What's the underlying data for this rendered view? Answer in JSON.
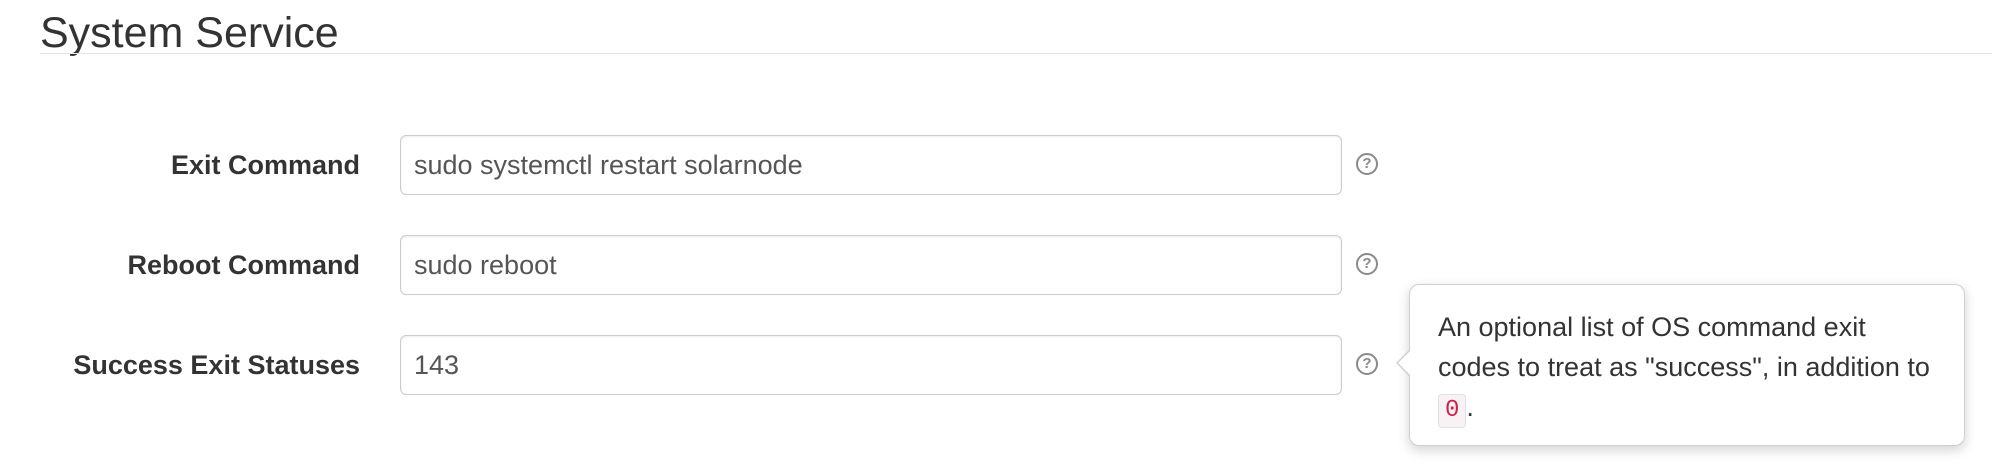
{
  "section": {
    "title": "System Service"
  },
  "fields": [
    {
      "label": "Exit Command",
      "value": "sudo systemctl restart solarnode"
    },
    {
      "label": "Reboot Command",
      "value": "sudo reboot"
    },
    {
      "label": "Success Exit Statuses",
      "value": "143"
    }
  ],
  "help_icon": {
    "glyph": "?"
  },
  "popover": {
    "text_before": "An optional list of OS command exit codes to treat as \"success\", in addition to ",
    "code": "0",
    "text_after": "."
  },
  "icons": {
    "help": "question-circle-icon"
  },
  "colors": {
    "code_text": "#c7254e",
    "code_background": "#f9f2f4"
  }
}
